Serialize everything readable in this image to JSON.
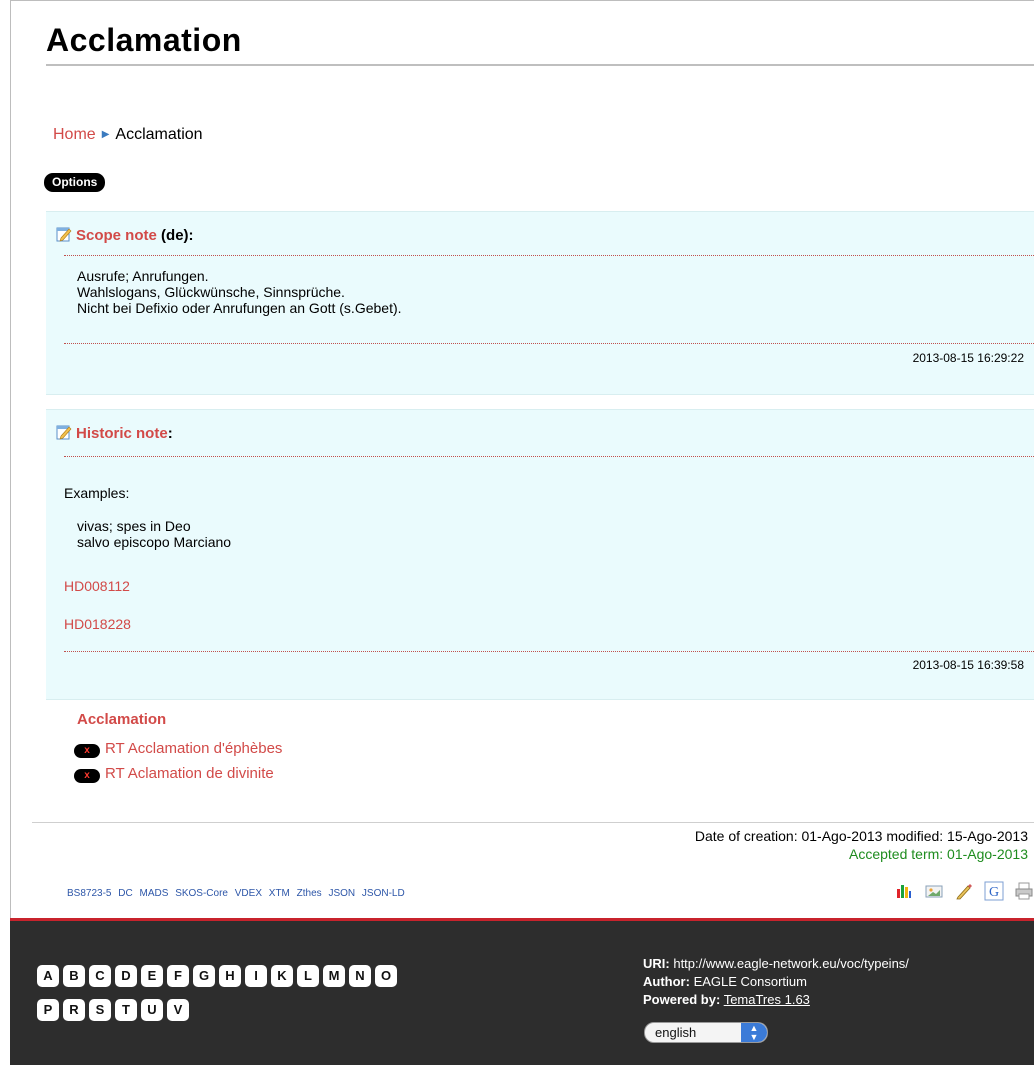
{
  "page": {
    "title": "Acclamation"
  },
  "breadcrumb": {
    "home": "Home",
    "current": "Acclamation"
  },
  "options_label": "Options",
  "scope_note": {
    "label": "Scope note",
    "lang": "(de):",
    "lines": [
      "Ausrufe; Anrufungen.",
      "Wahlslogans, Glückwünsche, Sinnsprüche.",
      "Nicht bei Defixio oder Anrufungen an Gott (s.Gebet)."
    ],
    "timestamp": "2013-08-15 16:29:22"
  },
  "historic_note": {
    "label": "Historic note",
    "colon": ":",
    "intro": "Examples:",
    "examples": [
      "vivas; spes in Deo",
      "salvo episcopo Marciano"
    ],
    "links": [
      "HD008112",
      "HD018228"
    ],
    "timestamp": "2013-08-15 16:39:58"
  },
  "related": {
    "title": "Acclamation",
    "delete_glyph": "x",
    "items": [
      "RT Acclamation d'éphèbes",
      "RT Aclamation de divinite"
    ]
  },
  "dates": {
    "creation": "Date of creation: 01-Ago-2013",
    "modified": "modified: 15-Ago-2013",
    "accepted": "Accepted term: 01-Ago-2013"
  },
  "formats": [
    "BS8723-5",
    "DC",
    "MADS",
    "SKOS-Core",
    "VDEX",
    "XTM",
    "Zthes",
    "JSON",
    "JSON-LD"
  ],
  "tool_icons": [
    "stats-icon",
    "image-icon",
    "edit-icon",
    "google-icon",
    "print-icon"
  ],
  "letters_row1": [
    "A",
    "B",
    "C",
    "D",
    "E",
    "F",
    "G",
    "H",
    "I",
    "K",
    "L",
    "M",
    "N",
    "O"
  ],
  "letters_row2": [
    "P",
    "R",
    "S",
    "T",
    "U",
    "V"
  ],
  "footer": {
    "uri_label": "URI:",
    "uri_value": "http://www.eagle-network.eu/voc/typeins/",
    "author_label": "Author:",
    "author_value": "EAGLE Consortium",
    "powered_label": "Powered by:",
    "powered_value": "TemaTres 1.63",
    "language": "english"
  },
  "colors": {
    "link": "#d24a48",
    "note_bg": "#eafbfd",
    "footer_bg": "#2d2d2d",
    "footer_accent": "#c8232c",
    "accepted": "#1e8c1e"
  }
}
